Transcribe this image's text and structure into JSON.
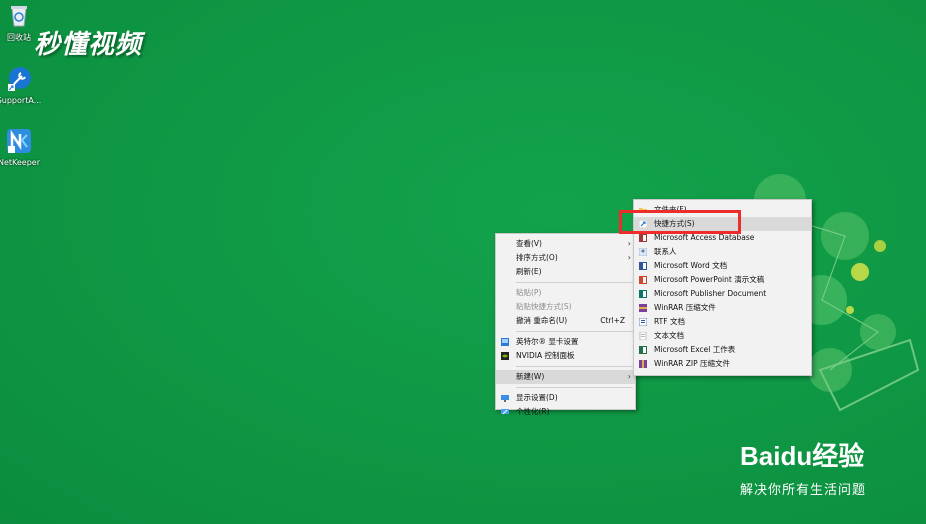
{
  "desktop": {
    "icons": [
      {
        "label": "回收站",
        "icon": "recycle-bin-icon"
      },
      {
        "label": "SupportA...",
        "icon": "wrench-icon"
      },
      {
        "label": "NetKeeper",
        "icon": "netkeeper-icon"
      }
    ]
  },
  "watermark_top": "秒懂视频",
  "watermark_bottom": {
    "logo": "Baidu经验",
    "slogan": "解决你所有生活问题"
  },
  "context_menu": {
    "items": [
      {
        "label": "查看(V)",
        "submenu": true
      },
      {
        "label": "排序方式(O)",
        "submenu": true
      },
      {
        "label": "刷新(E)"
      },
      {
        "label": "粘贴(P)",
        "disabled": true
      },
      {
        "label": "粘贴快捷方式(S)",
        "disabled": true
      },
      {
        "label": "撤消 重命名(U)",
        "accelerator": "Ctrl+Z"
      },
      {
        "label": "英特尔® 显卡设置",
        "icon": "intel-graphics-icon"
      },
      {
        "label": "NVIDIA 控制面板",
        "icon": "nvidia-icon"
      },
      {
        "label": "新建(W)",
        "submenu": true,
        "highlighted": true
      },
      {
        "label": "显示设置(D)",
        "icon": "display-icon"
      },
      {
        "label": "个性化(R)",
        "icon": "personalize-icon"
      }
    ]
  },
  "new_submenu": {
    "items": [
      {
        "label": "文件夹(F)",
        "icon": "folder-icon"
      },
      {
        "label": "快捷方式(S)",
        "icon": "shortcut-icon",
        "highlighted": true
      },
      {
        "label": "Microsoft Access Database",
        "icon": "access-icon"
      },
      {
        "label": "联系人",
        "icon": "contact-icon"
      },
      {
        "label": "Microsoft Word 文档",
        "icon": "word-icon"
      },
      {
        "label": "Microsoft PowerPoint 演示文稿",
        "icon": "powerpoint-icon"
      },
      {
        "label": "Microsoft Publisher Document",
        "icon": "publisher-icon"
      },
      {
        "label": "WinRAR 压缩文件",
        "icon": "winrar-icon"
      },
      {
        "label": "RTF 文档",
        "icon": "rtf-icon"
      },
      {
        "label": "文本文档",
        "icon": "text-doc-icon"
      },
      {
        "label": "Microsoft Excel 工作表",
        "icon": "excel-icon"
      },
      {
        "label": "WinRAR ZIP 压缩文件",
        "icon": "winrar-zip-icon"
      }
    ]
  },
  "colors": {
    "desktop_bg": "#0f9a45",
    "menu_bg": "#f2f2f2",
    "highlight_box": "#ee2c2c"
  }
}
